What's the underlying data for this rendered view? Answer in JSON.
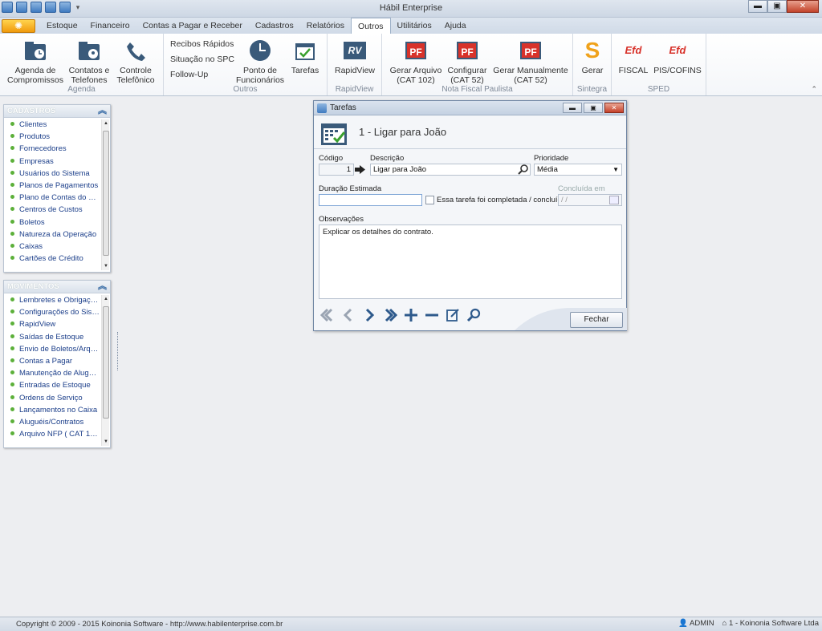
{
  "app": {
    "title": "Hábil Enterprise"
  },
  "window_controls": {
    "minimize": "▬",
    "maximize": "▣",
    "close": "✕"
  },
  "menu": {
    "tabs": [
      "Estoque",
      "Financeiro",
      "Contas a Pagar e Receber",
      "Cadastros",
      "Relatórios",
      "Outros",
      "Utilitários",
      "Ajuda"
    ],
    "active": "Outros"
  },
  "ribbon": {
    "agenda": {
      "caption": "Agenda",
      "b1": "Agenda de",
      "b1b": "Compromissos",
      "b2": "Contatos e",
      "b2b": "Telefones",
      "b3": "Controle",
      "b3b": "Telefônico"
    },
    "outros": {
      "caption": "Outros",
      "s1": "Recibos Rápidos",
      "s2": "Situação no SPC",
      "s3": "Follow-Up",
      "b1": "Ponto de",
      "b1b": "Funcionários",
      "b2": "Tarefas"
    },
    "rapidview": {
      "caption": "RapidView",
      "b1": "RapidView",
      "icon": "RV"
    },
    "nfp": {
      "caption": "Nota Fiscal Paulista",
      "b1": "Gerar Arquivo",
      "b1b": "(CAT 102)",
      "b2": "Configurar",
      "b2b": "(CAT 52)",
      "b3": "Gerar Manualmente",
      "b3b": "(CAT 52)",
      "icon": "PF"
    },
    "sintegra": {
      "caption": "Sintegra",
      "b1": "Gerar",
      "icon": "S"
    },
    "sped": {
      "caption": "SPED",
      "b1": "FISCAL",
      "b2": "PIS/COFINS",
      "icon": "Efd"
    }
  },
  "cadastros": {
    "title": "CADASTROS",
    "items": [
      "Clientes",
      "Produtos",
      "Fornecedores",
      "Empresas",
      "Usuários do Sistema",
      "Planos de Pagamentos",
      "Plano de Contas do Ca...",
      "Centros de Custos",
      "Boletos",
      "Natureza da Operação",
      "Caixas",
      "Cartões de Crédito"
    ]
  },
  "movimentos": {
    "title": "MOVIMENTOS",
    "items": [
      "Lembretes e Obrigaçõ...",
      "Configurações do Siste...",
      "RapidView",
      "Saídas de Estoque",
      "Envio de Boletos/Arqui...",
      "Contas a Pagar",
      "Manutenção de Alugué...",
      "Entradas de Estoque",
      "Ordens de Serviço",
      "Lançamentos no Caixa",
      "Aluguéis/Contratos",
      "Arquivo NFP ( CAT 102..."
    ]
  },
  "dialog": {
    "title": "Tarefas",
    "header": "1 - Ligar para João",
    "codigo_label": "Código",
    "codigo_value": "1",
    "descricao_label": "Descrição",
    "descricao_value": "Ligar para João",
    "prioridade_label": "Prioridade",
    "prioridade_value": "Média",
    "duracao_label": "Duração Estimada",
    "duracao_value": "",
    "completed_label": "Essa tarefa foi completada / concluída",
    "concluida_label": "Concluída em",
    "concluida_value": " /  /",
    "obs_label": "Observações",
    "obs_value": "Explicar os detalhes do contrato.",
    "close_button": "Fechar"
  },
  "status": {
    "copyright": "Copyright © 2009 - 2015 Koinonia Software - http://www.habilenterprise.com.br",
    "user": "ADMIN",
    "company": "1 - Koinonia Software Ltda"
  },
  "colors": {
    "accent": "#3f7bc0",
    "bullet": "#5cb03a",
    "pf_red": "#d8322a",
    "sintegra_orange": "#f0a21b"
  }
}
